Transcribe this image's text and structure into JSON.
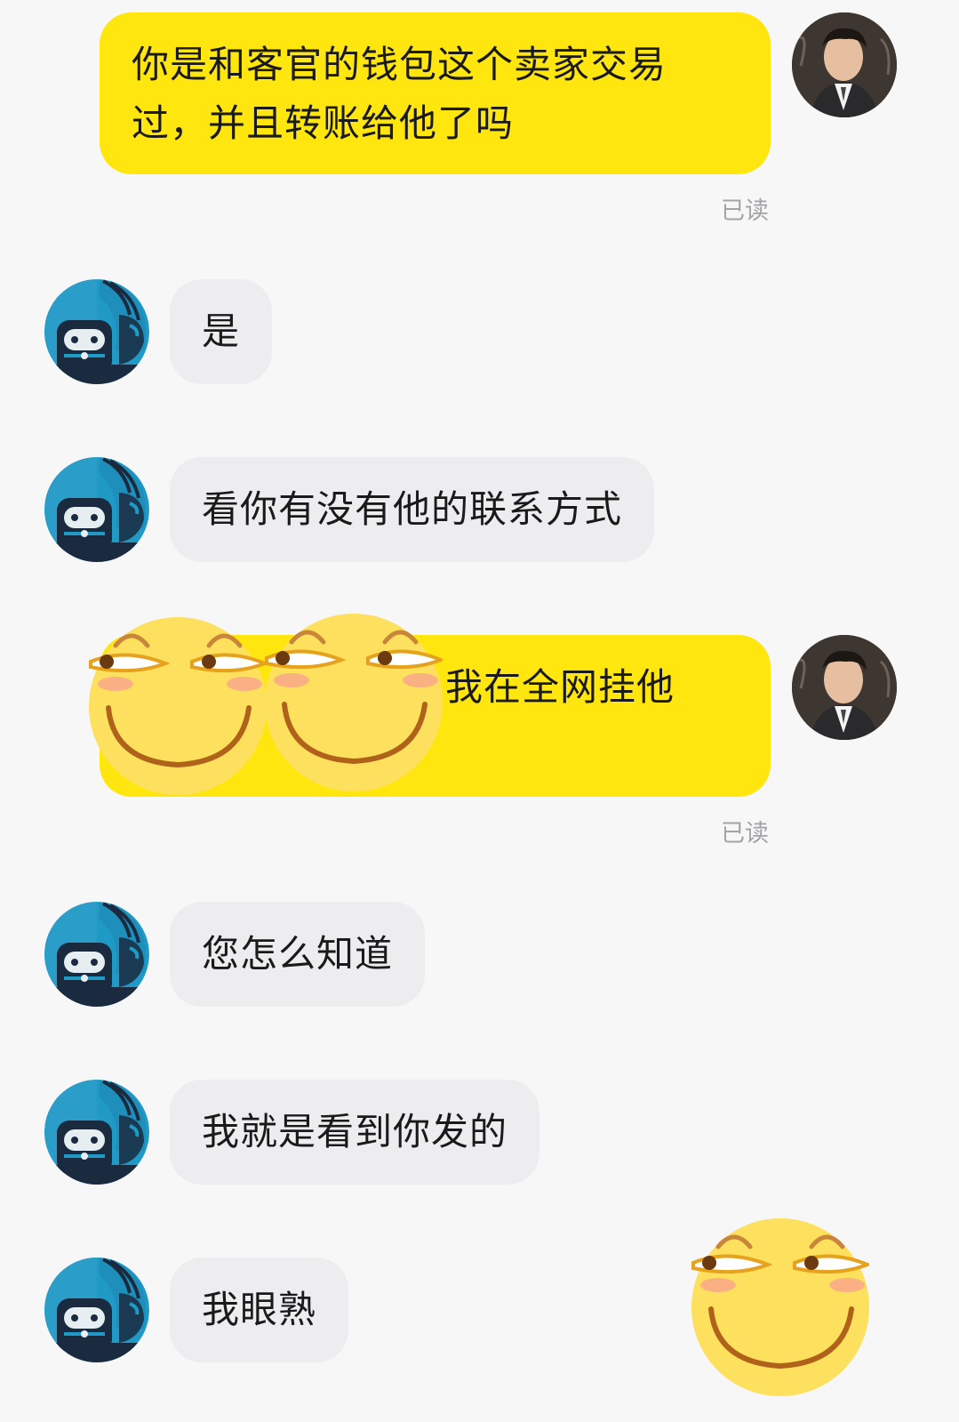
{
  "colors": {
    "background": "#f7f7f8",
    "self_bubble": "#ffe60f",
    "other_bubble": "#ededf0",
    "read_label": "#a3a3a8"
  },
  "messages": [
    {
      "sender": "self",
      "text": "你是和客官的钱包这个卖家交易过，并且转账给他了吗",
      "status": "已读"
    },
    {
      "sender": "other",
      "text": "是"
    },
    {
      "sender": "other",
      "text": "看你有没有他的联系方式"
    },
    {
      "sender": "self",
      "text": "我在全网挂他",
      "status": "已读",
      "stickers": [
        "smirk-emoji",
        "smirk-emoji"
      ]
    },
    {
      "sender": "other",
      "text": "您怎么知道"
    },
    {
      "sender": "other",
      "text": "我就是看到你发的"
    },
    {
      "sender": "other",
      "text": "我眼熟"
    }
  ],
  "floating_sticker": "smirk-emoji"
}
